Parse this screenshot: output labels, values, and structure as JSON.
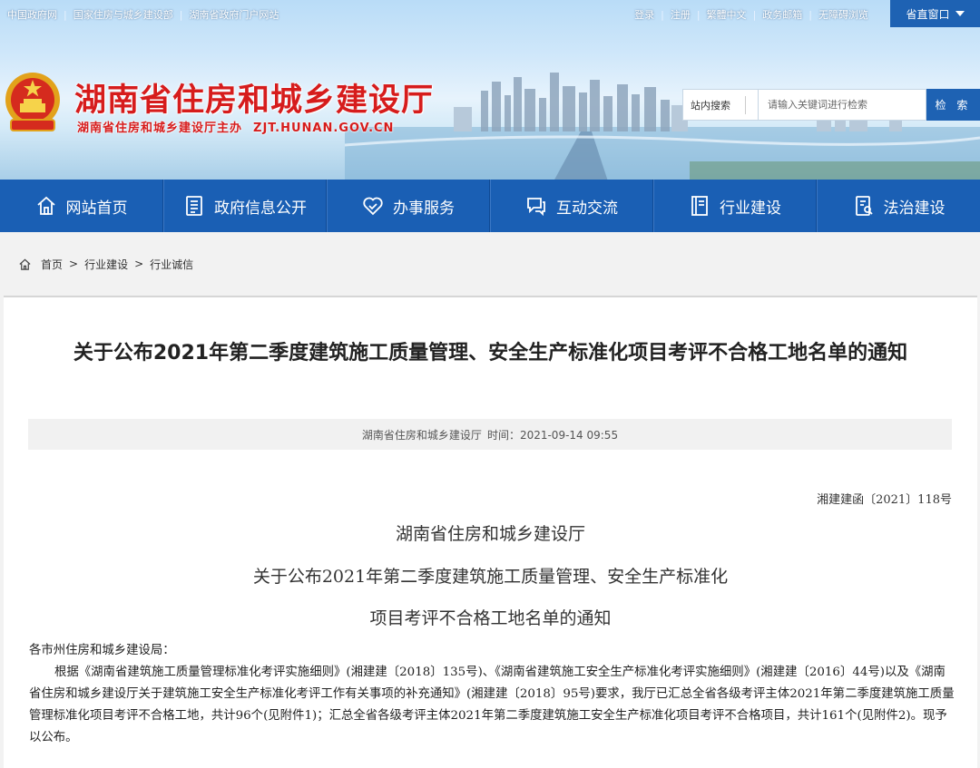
{
  "topbar": {
    "left_links": [
      "中国政府网",
      "国家住房与城乡建设部",
      "湖南省政府门户网站"
    ],
    "right_links": [
      "登录",
      "注册",
      "繁體中文",
      "政务邮箱",
      "无障碍浏览"
    ],
    "province_button": "省直窗口"
  },
  "header": {
    "site_title": "湖南省住房和城乡建设厅",
    "site_subtitle": "湖南省住房和城乡建设厅主办",
    "site_domain": "ZJT.HUNAN.GOV.CN"
  },
  "search": {
    "scope": "站内搜索",
    "placeholder": "请输入关键词进行检索",
    "button": "检 索"
  },
  "nav": {
    "items": [
      {
        "label": "网站首页",
        "icon": "home-icon"
      },
      {
        "label": "政府信息公开",
        "icon": "document-icon"
      },
      {
        "label": "办事服务",
        "icon": "heart-icon"
      },
      {
        "label": "互动交流",
        "icon": "chat-icon"
      },
      {
        "label": "行业建设",
        "icon": "book-icon"
      },
      {
        "label": "法治建设",
        "icon": "law-icon"
      }
    ]
  },
  "breadcrumb": {
    "items": [
      "首页",
      "行业建设",
      "行业诚信"
    ],
    "separator": ">"
  },
  "article": {
    "title": "关于公布2021年第二季度建筑施工质量管理、安全生产标准化项目考评不合格工地名单的通知",
    "source": "湖南省住房和城乡建设厅",
    "time": "时间：2021-09-14 09:55",
    "doc_number": "湘建建函〔2021〕118号",
    "heading_line1": "湖南省住房和城乡建设厅",
    "heading_line2": "关于公布2021年第二季度建筑施工质量管理、安全生产标准化",
    "heading_line3": "项目考评不合格工地名单的通知",
    "salutation": "各市州住房和城乡建设局：",
    "paragraph1": "根据《湖南省建筑施工质量管理标准化考评实施细则》(湘建建〔2018〕135号)、《湖南省建筑施工安全生产标准化考评实施细则》(湘建建〔2016〕44号)以及《湖南省住房和城乡建设厅关于建筑施工安全生产标准化考评工作有关事项的补充通知》(湘建建〔2018〕95号)要求，我厅已汇总全省各级考评主体2021年第二季度建筑施工质量管理标准化项目考评不合格工地，共计96个(见附件1)；汇总全省各级考评主体2021年第二季度建筑施工安全生产标准化项目考评不合格项目，共计161个(见附件2)。现予以公布。"
  },
  "colors": {
    "nav_blue": "#1a5fb4",
    "title_red": "#d61c1c"
  }
}
